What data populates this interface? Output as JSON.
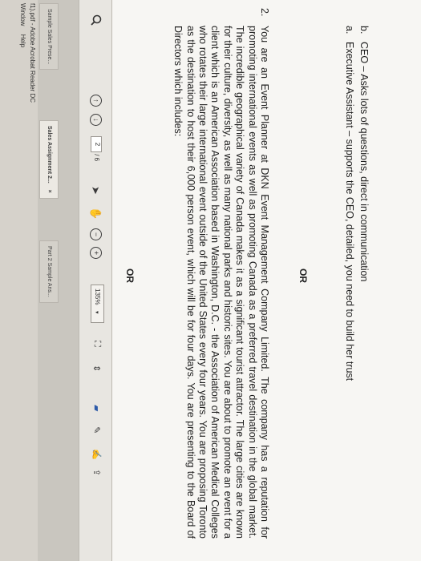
{
  "app": {
    "title": "f1).pdf - Adobe Acrobat Reader DC",
    "menu": [
      "Window",
      "Help"
    ]
  },
  "tabs": [
    {
      "label": "Sample Sales Prese..."
    },
    {
      "label": "Sales Assignment 2...",
      "close": "×"
    },
    {
      "label": "Part 2 Sample Ans..."
    }
  ],
  "toolbar": {
    "page_current": "2",
    "page_total": "/ 6",
    "zoom": "135%"
  },
  "document": {
    "or_top": "OR",
    "question_number": "2.",
    "question_text": "You are an Event Planner at DKN Event Management Company Limited. The company has a reputation for promoting international events as well as promoting Canada as a preferred travel destination in the global market. The incredible geographical variety of Canada makes it as a significant tourist attractor. The large cities are known for their culture, diversity, as well as many national parks and historic sites. You are about to promote an event for a client which is an American Association based in Washington, D.C. - the Association of American Medical Colleges who rotates their large international event outside of the United States every four years. You are proposing Toronto as the destination to host their 6,000 person event, which will be for four days. You are presenting to the Board of Directors which includes:",
    "options": [
      {
        "letter": "a.",
        "text": "Executive Assistant – supports the CEO, detailed, you need to build her trust"
      },
      {
        "letter": "b.",
        "text": "CEO – Asks lots of questions, direct in communication"
      }
    ],
    "or_bottom": "OR"
  }
}
